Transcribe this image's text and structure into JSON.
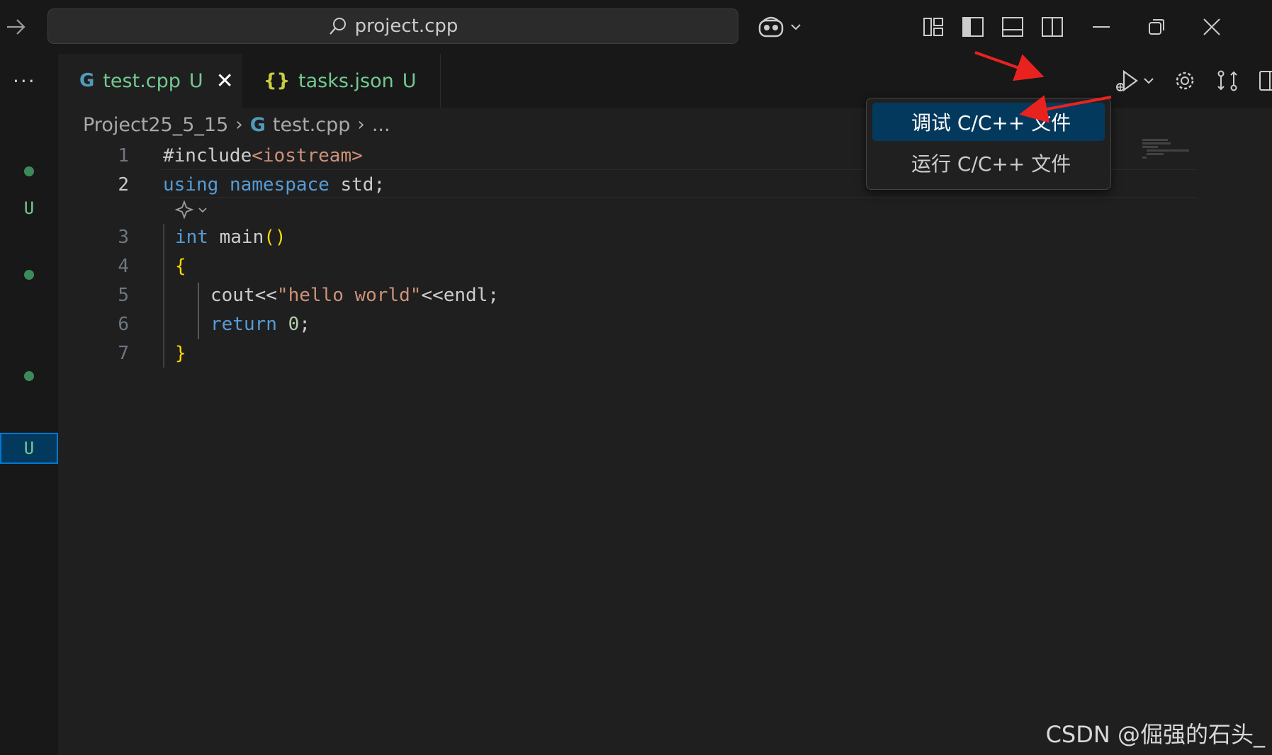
{
  "titlebar": {
    "search_text": "project.cpp",
    "icons": [
      "back-arrow-icon",
      "search-icon",
      "copilot-icon",
      "customize-layout-icon",
      "toggle-primary-sidebar-icon",
      "toggle-panel-icon",
      "toggle-secondary-sidebar-icon",
      "minimize-icon",
      "restore-icon",
      "close-icon"
    ]
  },
  "activity": {
    "more_label": "···",
    "badges": [
      "U",
      "U"
    ]
  },
  "tabs": [
    {
      "icon": "G",
      "label": "test.cpp",
      "status": "U",
      "close": "✕"
    },
    {
      "icon": "{}",
      "label": "tasks.json",
      "status": "U"
    }
  ],
  "breadcrumb": {
    "folder": "Project25_5_15",
    "file_icon": "G",
    "file": "test.cpp",
    "tail": "..."
  },
  "code": {
    "line_numbers": [
      "1",
      "2",
      "3",
      "4",
      "5",
      "6",
      "7"
    ],
    "l1_pre": "#include",
    "l1_inc": "<iostream>",
    "l2_kw1": "using",
    "l2_kw2": "namespace",
    "l2_rest": " std;",
    "l3_type": "int",
    "l3_fn": " main",
    "l3_par": "()",
    "l4_brace": "{",
    "l5_a": "cout<<",
    "l5_str": "\"hello world\"",
    "l5_b": "<<endl;",
    "l6_ret": "return",
    "l6_num": " 0",
    "l6_semi": ";",
    "l7_brace": "}"
  },
  "run_menu": {
    "items": [
      "调试 C/C++ 文件",
      "运行 C/C++ 文件"
    ]
  },
  "colors": {
    "accent": "#0078d4",
    "menu_highlight": "#04395e",
    "git_untracked": "#73c991",
    "annotation_red": "#e8231f"
  },
  "watermark": "CSDN @倔强的石头_"
}
